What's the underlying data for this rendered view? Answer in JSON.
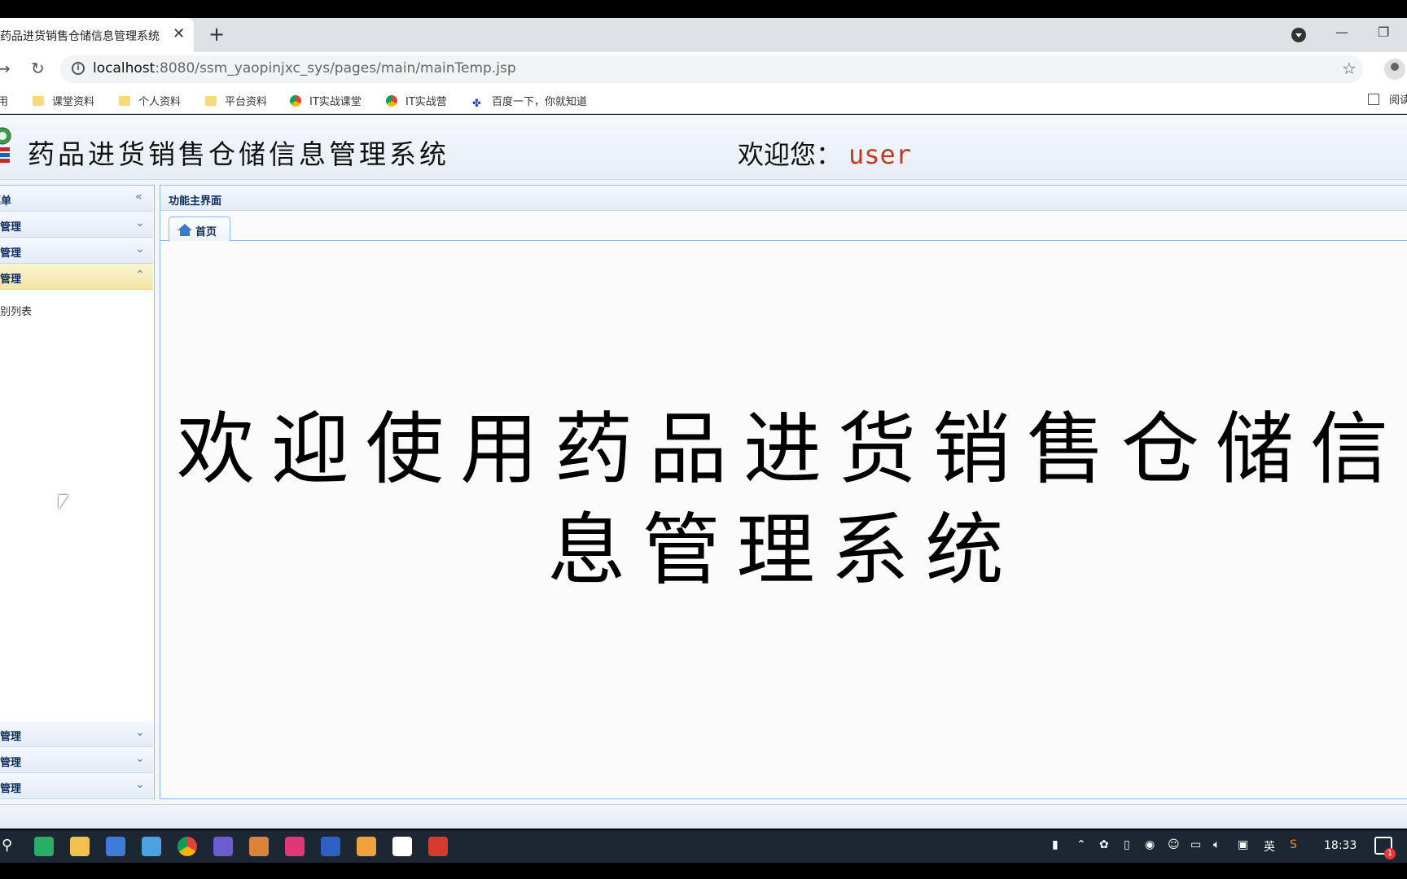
{
  "browser": {
    "tab_title": "药品进货销售仓储信息管理系统",
    "tab_close": "✕",
    "new_tab": "+",
    "url_host": "localhost",
    "url_path": ":8080/ssm_yaopinjxc_sys/pages/main/mainTemp.jsp",
    "bookmarks": [
      {
        "label": "课堂资料",
        "icon": "folder-icon"
      },
      {
        "label": "个人资料",
        "icon": "folder-icon"
      },
      {
        "label": "平台资料",
        "icon": "folder-icon"
      },
      {
        "label": "IT实战课堂",
        "icon": "chrome-icon"
      },
      {
        "label": "IT实战营",
        "icon": "chrome-icon"
      },
      {
        "label": "百度一下，你就知道",
        "icon": "baidu-icon"
      }
    ],
    "apps_label": "应用",
    "reader_label": "阅读"
  },
  "header": {
    "app_title": "药品进货销售仓储信息管理系统",
    "welcome_prefix": "欢迎您：",
    "username": "user"
  },
  "sidebar": {
    "title": "菜单",
    "panels": [
      {
        "label": "管理",
        "state": "collapsed"
      },
      {
        "label": "管理",
        "state": "collapsed"
      },
      {
        "label": "管理",
        "state": "expanded"
      },
      {
        "label": "管理",
        "state": "collapsed"
      },
      {
        "label": "管理",
        "state": "collapsed"
      },
      {
        "label": "管理",
        "state": "collapsed"
      }
    ],
    "expanded_link": "别列表"
  },
  "main": {
    "panel_title": "功能主界面",
    "home_tab": "首页",
    "welcome_line1": "欢迎使用药品进货销售仓储信",
    "welcome_line2": "息管理系统"
  },
  "taskbar": {
    "ime": "英",
    "time": "18:33",
    "notifications": "1"
  },
  "colors": {
    "accent_border": "#95b8e7",
    "username": "#c0392b",
    "active_panel": "#f5e6a6"
  }
}
